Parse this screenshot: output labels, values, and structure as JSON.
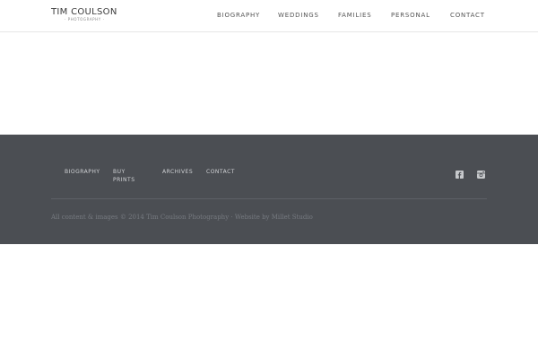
{
  "header": {
    "logo_name": "TIM COULSON",
    "logo_sub": "· PHOTOGRAPHY ·",
    "nav": [
      {
        "label": "BIOGRAPHY"
      },
      {
        "label": "WEDDINGS"
      },
      {
        "label": "FAMILIES"
      },
      {
        "label": "PERSONAL"
      },
      {
        "label": "CONTACT"
      }
    ]
  },
  "footer": {
    "nav": [
      {
        "label": "BIOGRAPHY"
      },
      {
        "label": "BUY PRINTS"
      },
      {
        "label": "ARCHIVES"
      },
      {
        "label": "CONTACT"
      }
    ],
    "copyright": "All content & images © 2014 Tim Coulson Photography · Website by Millet Studio",
    "social_icons": [
      "facebook-icon",
      "instagram-icon"
    ]
  },
  "colors": {
    "footer_bg": "#4b4e53",
    "header_border": "#e6e6e6"
  }
}
